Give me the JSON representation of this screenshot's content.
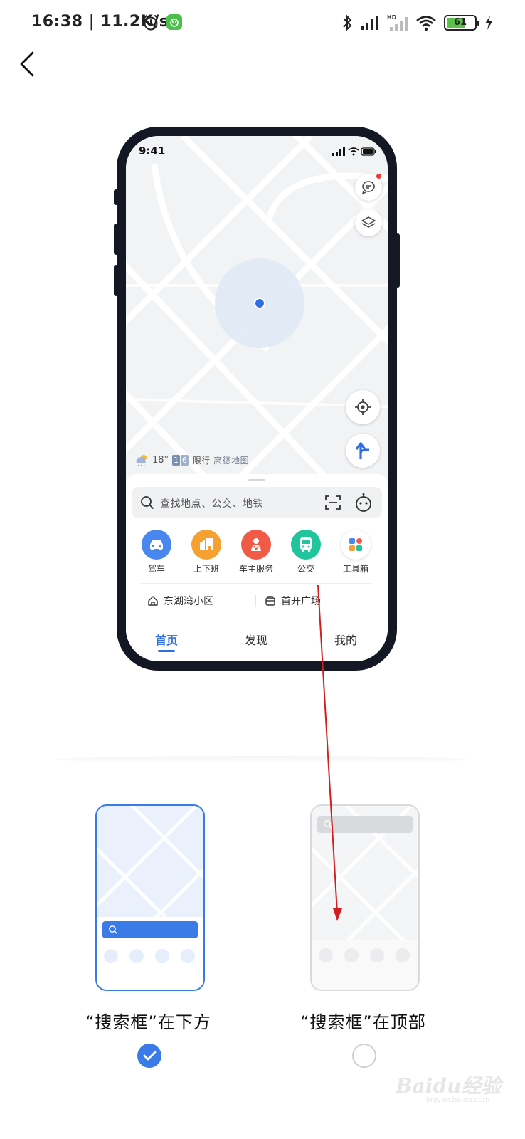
{
  "status_bar": {
    "time": "16:38 | 11.2K/s",
    "battery": "61",
    "icons": [
      "alarm-icon",
      "app-notification-icon",
      "bluetooth-icon",
      "signal-icon",
      "hd-signal-icon",
      "wifi-icon",
      "battery-icon",
      "charging-icon"
    ]
  },
  "nav": {
    "back_icon": "chevron-left-icon"
  },
  "phone_preview": {
    "time": "9:41",
    "weather": {
      "temp": "18°",
      "limit": [
        "1",
        "6"
      ],
      "limit_label": "限行",
      "brand": "高德地图"
    },
    "search_placeholder": "查找地点、公交、地铁",
    "quick_actions": [
      {
        "label": "驾车",
        "color": "#4a86f0",
        "icon": "car-icon"
      },
      {
        "label": "上下班",
        "color": "#f5a030",
        "icon": "commute-icon"
      },
      {
        "label": "车主服务",
        "color": "#f25a48",
        "icon": "car-owner-icon"
      },
      {
        "label": "公交",
        "color": "#22c49b",
        "icon": "bus-icon"
      },
      {
        "label": "工具箱",
        "color": "#ffffff",
        "icon": "toolbox-icon"
      }
    ],
    "places": [
      {
        "label": "东湖湾小区",
        "icon": "home-icon"
      },
      {
        "label": "首开广场",
        "icon": "work-icon"
      }
    ],
    "tabs": [
      {
        "label": "首页",
        "active": true
      },
      {
        "label": "发现",
        "active": false
      },
      {
        "label": "我的",
        "active": false
      }
    ]
  },
  "options": [
    {
      "label": "“搜索框”在下方",
      "selected": true
    },
    {
      "label": "“搜索框”在顶部",
      "selected": false
    }
  ],
  "colors": {
    "accent": "#3a7be8",
    "annotation_arrow": "#d11f1f"
  },
  "watermark": {
    "text": "Baidu经验",
    "sub": "jingyan.baidu.com"
  }
}
